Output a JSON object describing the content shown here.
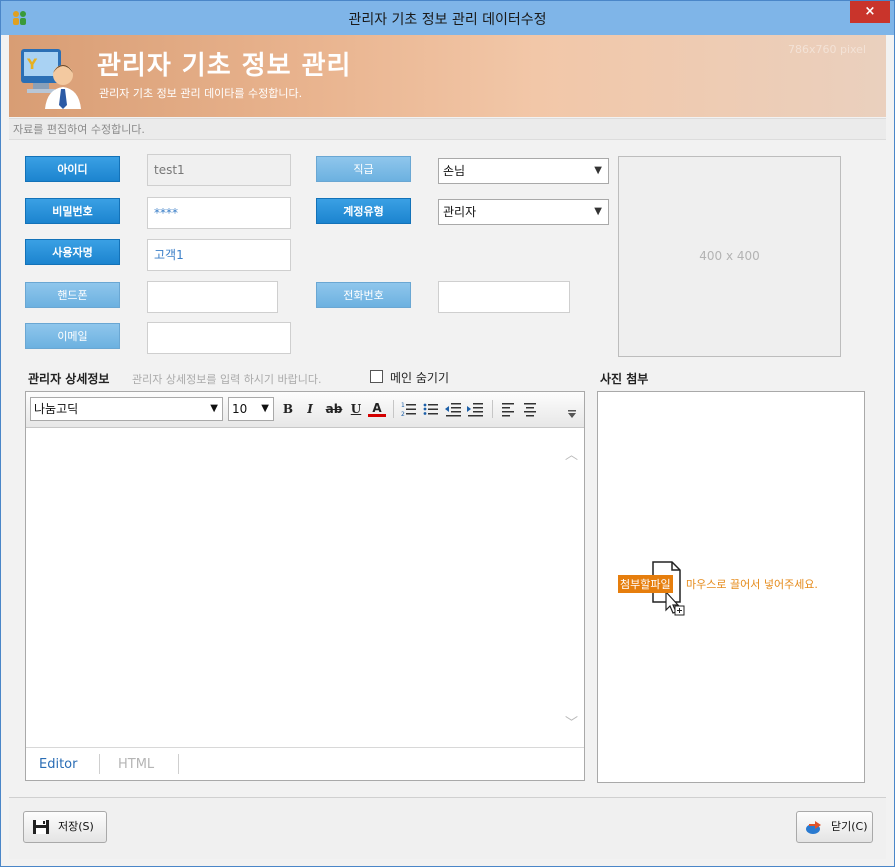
{
  "window": {
    "title": "관리자 기초 정보 관리 데이터수정",
    "close_label": "×"
  },
  "banner": {
    "title": "관리자 기초 정보 관리",
    "subtitle": "관리자 기초 정보 관리 데이타를 수정합니다.",
    "size_note": "786x760 pixel"
  },
  "notice": "자료를 편집하여 수정합니다.",
  "form": {
    "id_label": "아이디",
    "id_value": "test1",
    "rank_label": "직급",
    "rank_value": "손님",
    "password_label": "비밀번호",
    "password_value": "****",
    "account_type_label": "계정유형",
    "account_type_value": "관리자",
    "username_label": "사용자명",
    "username_value": "고객1",
    "mobile_label": "핸드폰",
    "mobile_value": "",
    "phone_label": "전화번호",
    "phone_value": "",
    "email_label": "이메일",
    "email_value": ""
  },
  "photo_box_size": "400 x 400",
  "detail": {
    "title": "관리자 상세정보",
    "hint": "관리자 상세정보를 입력 하시기 바랍니다.",
    "hide_main_label": "메인 숨기기"
  },
  "editor": {
    "font_value": "나눔고딕",
    "size_value": "10",
    "bold": "B",
    "italic": "I",
    "strike": "ab",
    "underline": "U",
    "font_color": "A",
    "tab_editor": "Editor",
    "tab_html": "HTML"
  },
  "attach": {
    "title": "사진 첨부",
    "badge": "첨부할파일",
    "text": "마우스로 끌어서 넣어주세요."
  },
  "footer": {
    "save_label": "저장(S)",
    "close_label": "닫기(C)"
  },
  "colors": {
    "label_blue": "#1c84cf",
    "banner_orange": "#d89d74",
    "attach_orange": "#e67e0d",
    "close_red": "#c9342b"
  }
}
